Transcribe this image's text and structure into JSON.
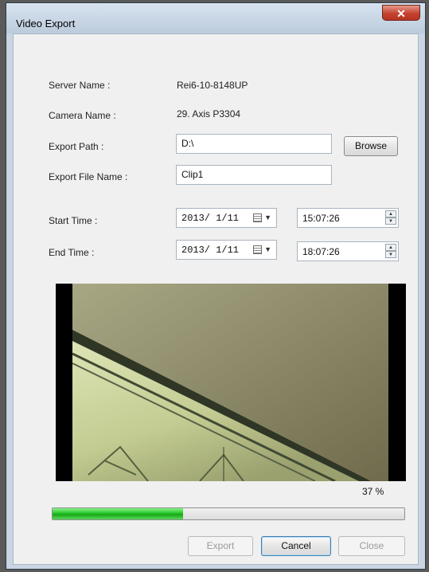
{
  "window": {
    "title": "Video Export",
    "close_glyph": "✕"
  },
  "labels": {
    "server_name": "Server Name :",
    "camera_name": "Camera Name :",
    "export_path": "Export Path :",
    "export_file_name": "Export File Name :",
    "start_time": "Start Time :",
    "end_time": "End Time :"
  },
  "values": {
    "server_name": "Rei6-10-8148UP",
    "camera_name": "29. Axis P3304"
  },
  "inputs": {
    "export_path": "D:\\",
    "export_file_name": "Clip1",
    "start_date": "2013/ 1/11",
    "start_time": "15:07:26",
    "end_date": "2013/ 1/11",
    "end_time": "18:07:26"
  },
  "buttons": {
    "browse": "Browse",
    "export": "Export",
    "cancel": "Cancel",
    "close": "Close"
  },
  "progress": {
    "text": "37 %",
    "fraction": 0.37
  },
  "colors": {
    "progress_fill": "#1fbd1f",
    "close_button": "#c4432f"
  }
}
